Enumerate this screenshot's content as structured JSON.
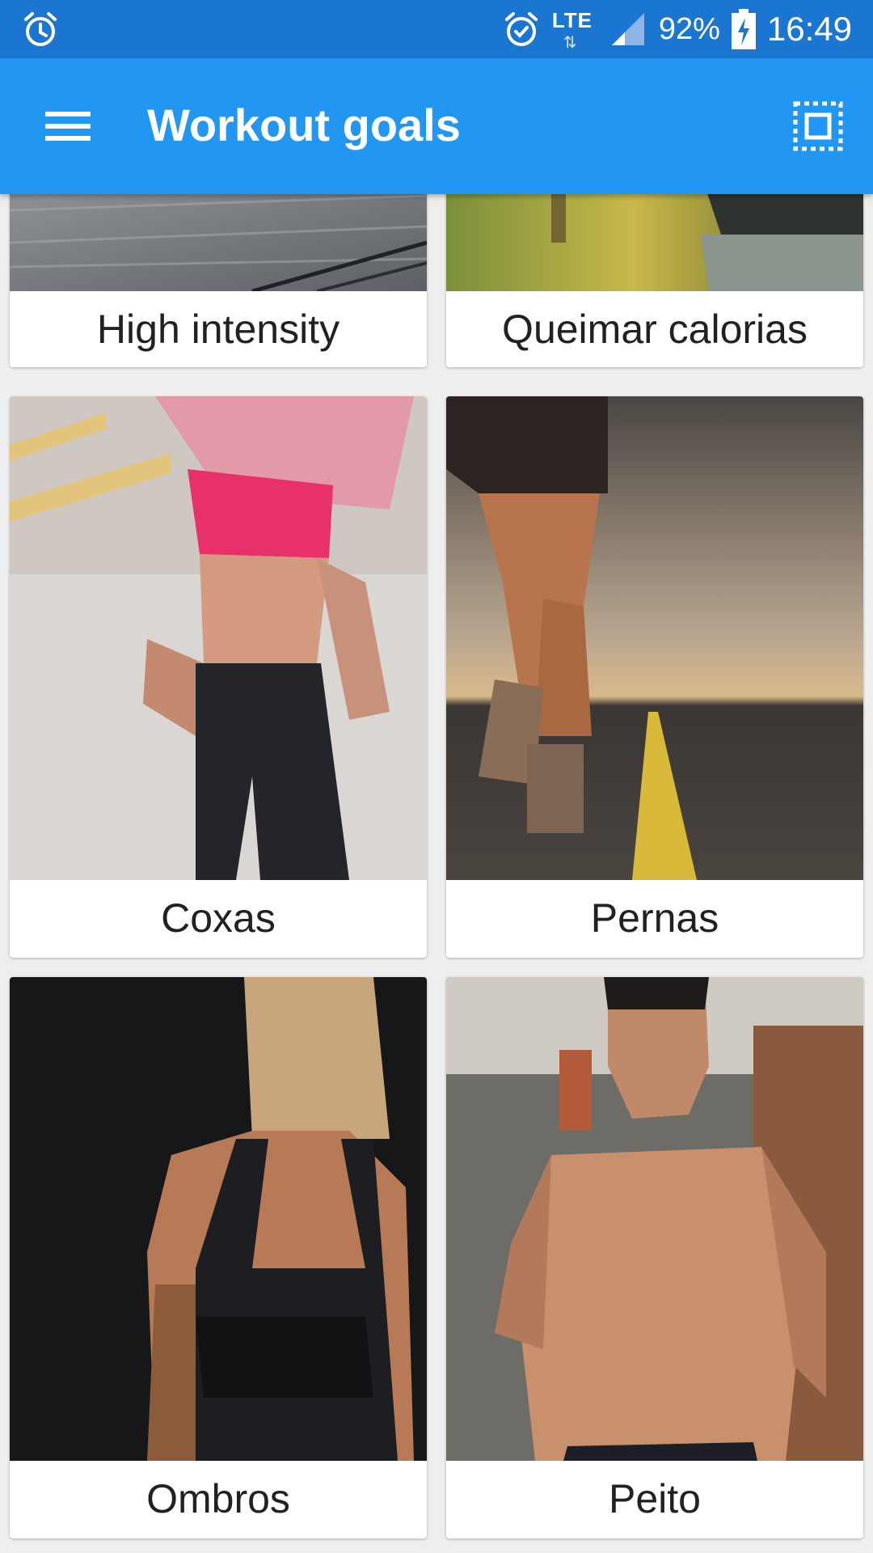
{
  "status_bar": {
    "battery": "92%",
    "time": "16:49",
    "network": "LTE",
    "icons": [
      "alarm-icon",
      "alarm-icon",
      "lte-icon",
      "signal-icon",
      "battery-charging-icon"
    ]
  },
  "app_bar": {
    "title": "Workout goals",
    "menu_icon": "hamburger-menu-icon",
    "action_icon": "select-all-icon"
  },
  "goals": [
    {
      "label": "High intensity"
    },
    {
      "label": "Queimar calorias"
    },
    {
      "label": "Coxas"
    },
    {
      "label": "Pernas"
    },
    {
      "label": "Ombros"
    },
    {
      "label": "Peito"
    }
  ],
  "colors": {
    "status_bar": "#1b76d2",
    "app_bar": "#2196f3",
    "background": "#eeeeee",
    "card": "#ffffff",
    "text": "#212121"
  }
}
